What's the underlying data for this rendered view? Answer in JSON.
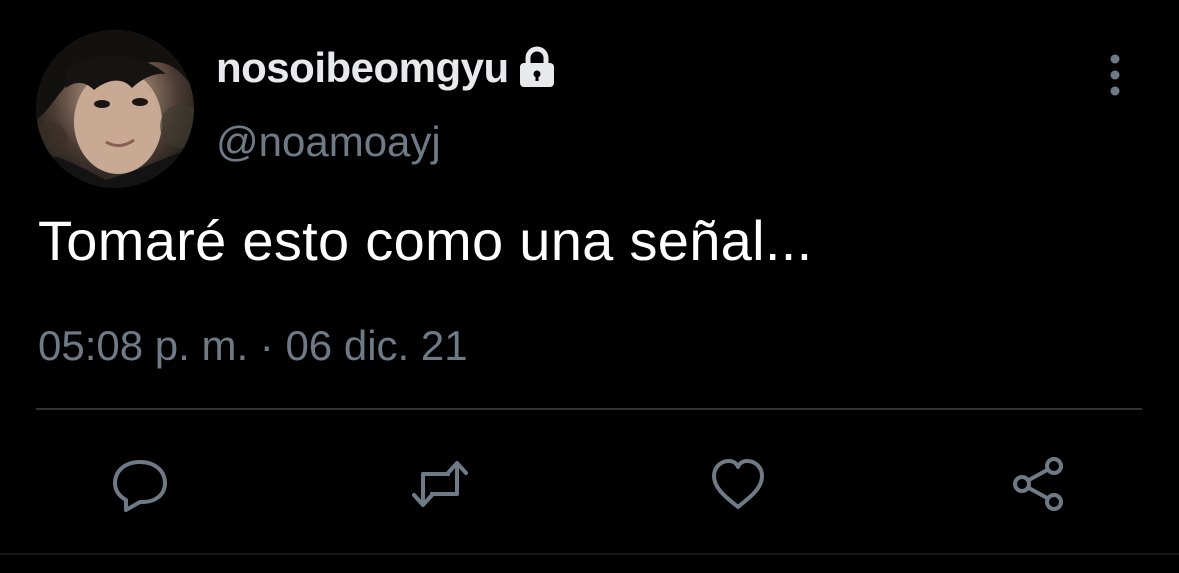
{
  "tweet": {
    "display_name": "nosoibeomgyu",
    "handle": "@noamoayj",
    "is_protected": true,
    "text": "Tomaré esto como una señal...",
    "timestamp": "05:08 p. m. · 06 dic. 21"
  },
  "icons": {
    "lock": "lock-icon",
    "more": "more-vertical-icon",
    "reply": "reply-icon",
    "retweet": "retweet-icon",
    "like": "heart-icon",
    "share": "share-icon"
  },
  "colors": {
    "background": "#000000",
    "primary_text": "#ffffff",
    "secondary_text": "#6e7a86",
    "icon": "#6e7a86",
    "divider": "#2f3336"
  }
}
